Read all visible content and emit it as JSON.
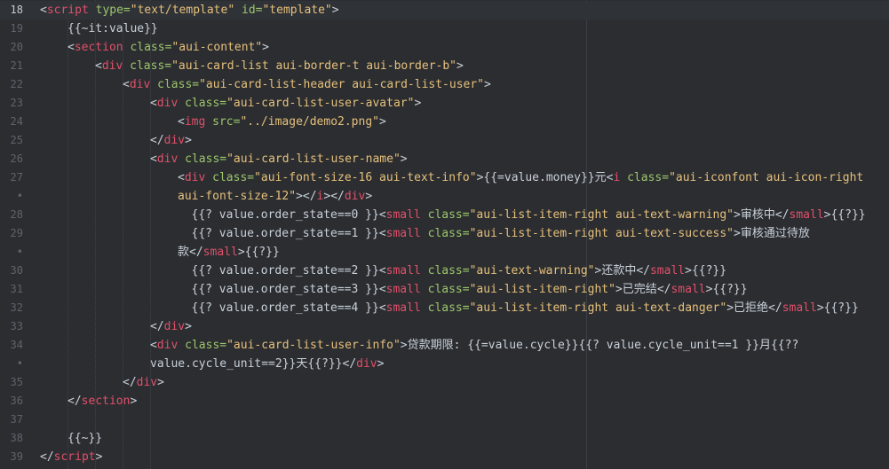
{
  "editor": {
    "active_line": "18",
    "lines": [
      {
        "num": "18",
        "indent": 0,
        "segments": [
          {
            "t": "punc",
            "v": "<"
          },
          {
            "t": "tag",
            "v": "script"
          },
          {
            "t": "txt",
            "v": " "
          },
          {
            "t": "attr",
            "v": "type="
          },
          {
            "t": "str",
            "v": "\"text/template\""
          },
          {
            "t": "txt",
            "v": " "
          },
          {
            "t": "attr",
            "v": "id="
          },
          {
            "t": "str",
            "v": "\"template\""
          },
          {
            "t": "punc",
            "v": ">"
          }
        ]
      },
      {
        "num": "19",
        "indent": 1,
        "segments": [
          {
            "t": "txt",
            "v": "{{~it:value}}"
          }
        ]
      },
      {
        "num": "20",
        "indent": 1,
        "segments": [
          {
            "t": "punc",
            "v": "<"
          },
          {
            "t": "tag",
            "v": "section"
          },
          {
            "t": "txt",
            "v": " "
          },
          {
            "t": "attr",
            "v": "class="
          },
          {
            "t": "str",
            "v": "\"aui-content\""
          },
          {
            "t": "punc",
            "v": ">"
          }
        ]
      },
      {
        "num": "21",
        "indent": 2,
        "segments": [
          {
            "t": "punc",
            "v": "<"
          },
          {
            "t": "tag",
            "v": "div"
          },
          {
            "t": "txt",
            "v": " "
          },
          {
            "t": "attr",
            "v": "class="
          },
          {
            "t": "str",
            "v": "\"aui-card-list aui-border-t aui-border-b\""
          },
          {
            "t": "punc",
            "v": ">"
          }
        ]
      },
      {
        "num": "22",
        "indent": 3,
        "segments": [
          {
            "t": "punc",
            "v": "<"
          },
          {
            "t": "tag",
            "v": "div"
          },
          {
            "t": "txt",
            "v": " "
          },
          {
            "t": "attr",
            "v": "class="
          },
          {
            "t": "str",
            "v": "\"aui-card-list-header aui-card-list-user\""
          },
          {
            "t": "punc",
            "v": ">"
          }
        ]
      },
      {
        "num": "23",
        "indent": 4,
        "segments": [
          {
            "t": "punc",
            "v": "<"
          },
          {
            "t": "tag",
            "v": "div"
          },
          {
            "t": "txt",
            "v": " "
          },
          {
            "t": "attr",
            "v": "class="
          },
          {
            "t": "str",
            "v": "\"aui-card-list-user-avatar\""
          },
          {
            "t": "punc",
            "v": ">"
          }
        ]
      },
      {
        "num": "24",
        "indent": 5,
        "segments": [
          {
            "t": "punc",
            "v": "<"
          },
          {
            "t": "tag",
            "v": "img"
          },
          {
            "t": "txt",
            "v": " "
          },
          {
            "t": "attr",
            "v": "src="
          },
          {
            "t": "str",
            "v": "\"../image/demo2.png\""
          },
          {
            "t": "punc",
            "v": ">"
          }
        ]
      },
      {
        "num": "25",
        "indent": 4,
        "segments": [
          {
            "t": "punc",
            "v": "</"
          },
          {
            "t": "tag",
            "v": "div"
          },
          {
            "t": "punc",
            "v": ">"
          }
        ]
      },
      {
        "num": "26",
        "indent": 4,
        "segments": [
          {
            "t": "punc",
            "v": "<"
          },
          {
            "t": "tag",
            "v": "div"
          },
          {
            "t": "txt",
            "v": " "
          },
          {
            "t": "attr",
            "v": "class="
          },
          {
            "t": "str",
            "v": "\"aui-card-list-user-name\""
          },
          {
            "t": "punc",
            "v": ">"
          }
        ]
      },
      {
        "num": "27",
        "indent": 5,
        "segments": [
          {
            "t": "punc",
            "v": "<"
          },
          {
            "t": "tag",
            "v": "div"
          },
          {
            "t": "txt",
            "v": " "
          },
          {
            "t": "attr",
            "v": "class="
          },
          {
            "t": "str",
            "v": "\"aui-font-size-16 aui-text-info\""
          },
          {
            "t": "punc",
            "v": ">"
          },
          {
            "t": "txt",
            "v": "{{=value.money}}元"
          },
          {
            "t": "punc",
            "v": "<"
          },
          {
            "t": "tag",
            "v": "i"
          },
          {
            "t": "txt",
            "v": " "
          },
          {
            "t": "attr",
            "v": "class="
          },
          {
            "t": "str",
            "v": "\"aui-iconfont aui-icon-right"
          }
        ]
      },
      {
        "num": "•",
        "indent": 5,
        "segments": [
          {
            "t": "str",
            "v": "aui-font-size-12\""
          },
          {
            "t": "punc",
            "v": "></"
          },
          {
            "t": "tag",
            "v": "i"
          },
          {
            "t": "punc",
            "v": "></"
          },
          {
            "t": "tag",
            "v": "div"
          },
          {
            "t": "punc",
            "v": ">"
          }
        ]
      },
      {
        "num": "28",
        "indent": 5.5,
        "segments": [
          {
            "t": "txt",
            "v": "{{? value.order_state==0 }}"
          },
          {
            "t": "punc",
            "v": "<"
          },
          {
            "t": "tag",
            "v": "small"
          },
          {
            "t": "txt",
            "v": " "
          },
          {
            "t": "attr",
            "v": "class="
          },
          {
            "t": "str",
            "v": "\"aui-list-item-right aui-text-warning\""
          },
          {
            "t": "punc",
            "v": ">"
          },
          {
            "t": "txt",
            "v": "审核中"
          },
          {
            "t": "punc",
            "v": "</"
          },
          {
            "t": "tag",
            "v": "small"
          },
          {
            "t": "punc",
            "v": ">"
          },
          {
            "t": "txt",
            "v": "{{?}}"
          }
        ]
      },
      {
        "num": "29",
        "indent": 5.5,
        "segments": [
          {
            "t": "txt",
            "v": "{{? value.order_state==1 }}"
          },
          {
            "t": "punc",
            "v": "<"
          },
          {
            "t": "tag",
            "v": "small"
          },
          {
            "t": "txt",
            "v": " "
          },
          {
            "t": "attr",
            "v": "class="
          },
          {
            "t": "str",
            "v": "\"aui-list-item-right aui-text-success\""
          },
          {
            "t": "punc",
            "v": ">"
          },
          {
            "t": "txt",
            "v": "审核通过待放"
          }
        ]
      },
      {
        "num": "•",
        "indent": 5,
        "segments": [
          {
            "t": "txt",
            "v": "款"
          },
          {
            "t": "punc",
            "v": "</"
          },
          {
            "t": "tag",
            "v": "small"
          },
          {
            "t": "punc",
            "v": ">"
          },
          {
            "t": "txt",
            "v": "{{?}}"
          }
        ]
      },
      {
        "num": "30",
        "indent": 5.5,
        "segments": [
          {
            "t": "txt",
            "v": "{{? value.order_state==2 }}"
          },
          {
            "t": "punc",
            "v": "<"
          },
          {
            "t": "tag",
            "v": "small"
          },
          {
            "t": "txt",
            "v": " "
          },
          {
            "t": "attr",
            "v": "class="
          },
          {
            "t": "str",
            "v": "\"aui-text-warning\""
          },
          {
            "t": "punc",
            "v": ">"
          },
          {
            "t": "txt",
            "v": "还款中"
          },
          {
            "t": "punc",
            "v": "</"
          },
          {
            "t": "tag",
            "v": "small"
          },
          {
            "t": "punc",
            "v": ">"
          },
          {
            "t": "txt",
            "v": "{{?}}"
          }
        ]
      },
      {
        "num": "31",
        "indent": 5.5,
        "segments": [
          {
            "t": "txt",
            "v": "{{? value.order_state==3 }}"
          },
          {
            "t": "punc",
            "v": "<"
          },
          {
            "t": "tag",
            "v": "small"
          },
          {
            "t": "txt",
            "v": " "
          },
          {
            "t": "attr",
            "v": "class="
          },
          {
            "t": "str",
            "v": "\"aui-list-item-right\""
          },
          {
            "t": "punc",
            "v": ">"
          },
          {
            "t": "txt",
            "v": "已完结"
          },
          {
            "t": "punc",
            "v": "</"
          },
          {
            "t": "tag",
            "v": "small"
          },
          {
            "t": "punc",
            "v": ">"
          },
          {
            "t": "txt",
            "v": "{{?}}"
          }
        ]
      },
      {
        "num": "32",
        "indent": 5.5,
        "segments": [
          {
            "t": "txt",
            "v": "{{? value.order_state==4 }}"
          },
          {
            "t": "punc",
            "v": "<"
          },
          {
            "t": "tag",
            "v": "small"
          },
          {
            "t": "txt",
            "v": " "
          },
          {
            "t": "attr",
            "v": "class="
          },
          {
            "t": "str",
            "v": "\"aui-list-item-right aui-text-danger\""
          },
          {
            "t": "punc",
            "v": ">"
          },
          {
            "t": "txt",
            "v": "已拒绝"
          },
          {
            "t": "punc",
            "v": "</"
          },
          {
            "t": "tag",
            "v": "small"
          },
          {
            "t": "punc",
            "v": ">"
          },
          {
            "t": "txt",
            "v": "{{?}}"
          }
        ]
      },
      {
        "num": "33",
        "indent": 4,
        "segments": [
          {
            "t": "punc",
            "v": "</"
          },
          {
            "t": "tag",
            "v": "div"
          },
          {
            "t": "punc",
            "v": ">"
          }
        ]
      },
      {
        "num": "34",
        "indent": 4,
        "segments": [
          {
            "t": "punc",
            "v": "<"
          },
          {
            "t": "tag",
            "v": "div"
          },
          {
            "t": "txt",
            "v": " "
          },
          {
            "t": "attr",
            "v": "class="
          },
          {
            "t": "str",
            "v": "\"aui-card-list-user-info\""
          },
          {
            "t": "punc",
            "v": ">"
          },
          {
            "t": "txt",
            "v": "贷款期限: {{=value.cycle}}{{? value.cycle_unit==1 }}月{{??"
          }
        ]
      },
      {
        "num": "•",
        "indent": 4,
        "segments": [
          {
            "t": "txt",
            "v": "value.cycle_unit==2}}天{{?}}"
          },
          {
            "t": "punc",
            "v": "</"
          },
          {
            "t": "tag",
            "v": "div"
          },
          {
            "t": "punc",
            "v": ">"
          }
        ]
      },
      {
        "num": "35",
        "indent": 3,
        "segments": [
          {
            "t": "punc",
            "v": "</"
          },
          {
            "t": "tag",
            "v": "div"
          },
          {
            "t": "punc",
            "v": ">"
          }
        ]
      },
      {
        "num": "36",
        "indent": 1,
        "segments": [
          {
            "t": "punc",
            "v": "</"
          },
          {
            "t": "tag",
            "v": "section"
          },
          {
            "t": "punc",
            "v": ">"
          }
        ]
      },
      {
        "num": "37",
        "indent": 0,
        "segments": []
      },
      {
        "num": "38",
        "indent": 1,
        "segments": [
          {
            "t": "txt",
            "v": "{{~}}"
          }
        ]
      },
      {
        "num": "39",
        "indent": 0,
        "segments": [
          {
            "t": "punc",
            "v": "</"
          },
          {
            "t": "tag",
            "v": "script"
          },
          {
            "t": "punc",
            "v": ">"
          }
        ]
      }
    ]
  },
  "colors": {
    "background": "#2b2d31",
    "tag": "#e0506a",
    "attribute": "#9ec66b",
    "string": "#e6c07b",
    "text": "#c9d1d9",
    "line_number": "#5f636b",
    "active_line_number": "#c8ccd2"
  }
}
